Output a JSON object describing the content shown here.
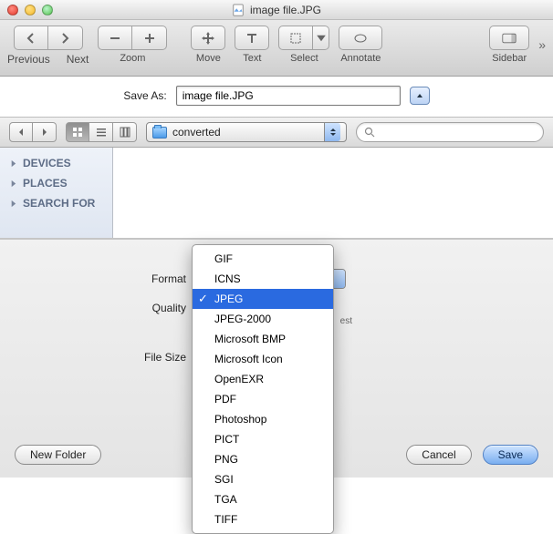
{
  "window": {
    "title": "image file.JPG"
  },
  "toolbar": {
    "previous": "Previous",
    "next": "Next",
    "zoom": "Zoom",
    "move": "Move",
    "text": "Text",
    "select": "Select",
    "annotate": "Annotate",
    "sidebar": "Sidebar"
  },
  "saveas": {
    "label": "Save As:",
    "value": "image file.JPG"
  },
  "nav": {
    "folder": "converted",
    "search_placeholder": ""
  },
  "sidebar": {
    "items": [
      {
        "label": "DEVICES"
      },
      {
        "label": "PLACES"
      },
      {
        "label": "SEARCH FOR"
      }
    ]
  },
  "options": {
    "format_label": "Format",
    "quality_label": "Quality",
    "quality_min": "",
    "quality_max": "est",
    "filesize_label": "File Size"
  },
  "format_menu": {
    "selected": "JPEG",
    "items": [
      "GIF",
      "ICNS",
      "JPEG",
      "JPEG-2000",
      "Microsoft BMP",
      "Microsoft Icon",
      "OpenEXR",
      "PDF",
      "Photoshop",
      "PICT",
      "PNG",
      "SGI",
      "TGA",
      "TIFF"
    ]
  },
  "buttons": {
    "new_folder": "New Folder",
    "cancel": "Cancel",
    "save": "Save"
  }
}
